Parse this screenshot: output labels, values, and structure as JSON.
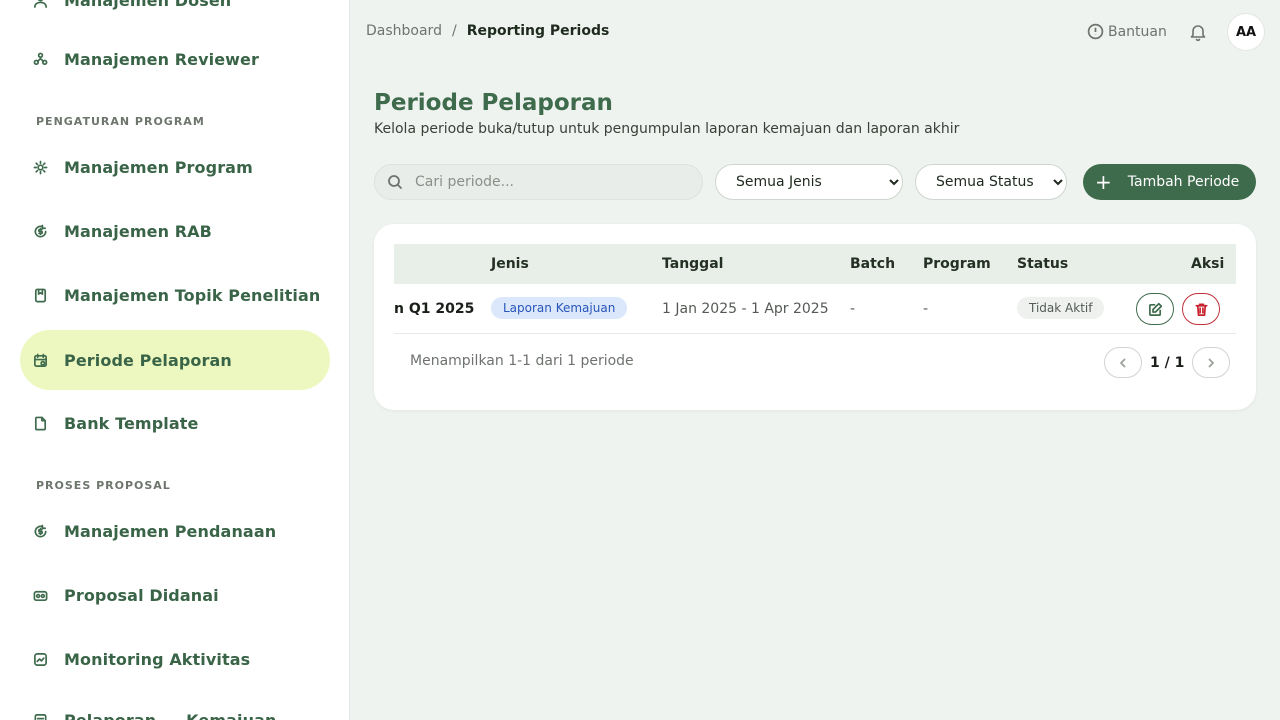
{
  "sidebar": {
    "items": [
      {
        "label": "Manajemen Dosen",
        "icon": "user-icon"
      },
      {
        "label": "Manajemen Reviewer",
        "icon": "users-icon"
      },
      {
        "label": "Manajemen Program",
        "icon": "gear-icon"
      },
      {
        "label": "Manajemen RAB",
        "icon": "dollar-cycle-icon"
      },
      {
        "label": "Manajemen Topik Penelitian",
        "icon": "bookmark-icon"
      },
      {
        "label": "Periode Pelaporan",
        "icon": "calendar-icon",
        "active": true
      },
      {
        "label": "Bank Template",
        "icon": "file-icon"
      },
      {
        "label": "Manajemen Pendanaan",
        "icon": "dollar-cycle-icon"
      },
      {
        "label": "Proposal Didanai",
        "icon": "money-icon"
      },
      {
        "label": "Monitoring Aktivitas",
        "icon": "activity-icon"
      },
      {
        "label": "Pelaporan ... Kemajuan",
        "icon": "report-icon"
      }
    ],
    "sections": {
      "program": "Pengaturan Program",
      "proposal": "Proses Proposal"
    }
  },
  "header": {
    "breadcrumb": {
      "parent": "Dashboard",
      "separator": "/",
      "current": "Reporting Periods"
    },
    "help_label": "Bantuan",
    "avatar_initials": "AA"
  },
  "page": {
    "title": "Periode Pelaporan",
    "subtitle": "Kelola periode buka/tutup untuk pengumpulan laporan kemajuan dan laporan akhir"
  },
  "toolbar": {
    "search_placeholder": "Cari periode...",
    "filter_type_selected": "Semua Jenis",
    "filter_status_selected": "Semua Status",
    "add_label": "Tambah Periode"
  },
  "table": {
    "columns": {
      "jenis": "Jenis",
      "tanggal": "Tanggal",
      "batch": "Batch",
      "program": "Program",
      "status": "Status",
      "aksi": "Aksi"
    },
    "rows": [
      {
        "name": "n Q1 2025",
        "jenis": "Laporan Kemajuan",
        "tanggal": "1 Jan 2025 - 1 Apr 2025",
        "batch": "-",
        "program": "-",
        "status": "Tidak Aktif"
      }
    ],
    "footer": "Menampilkan 1-1 dari 1 periode",
    "page_indicator": "1 / 1"
  },
  "colors": {
    "primary": "#3f6b4d",
    "active_nav_bg": "#ecf8c0",
    "badge_blue_bg": "#dbe7fb",
    "badge_blue_text": "#2855b8",
    "danger": "#c8202c"
  }
}
